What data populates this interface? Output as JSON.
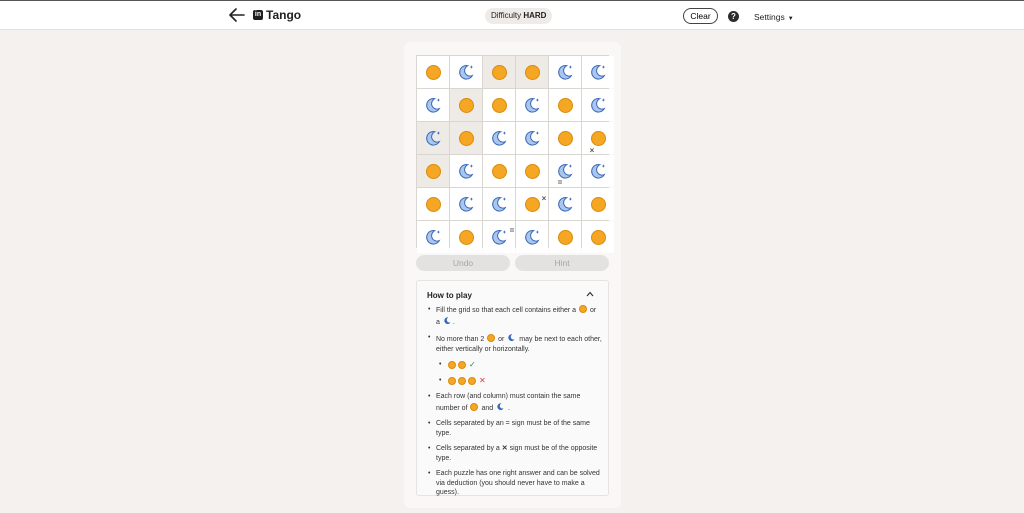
{
  "header": {
    "title": "Tango",
    "logo_text": "in",
    "difficulty_label": "Difficulty",
    "difficulty_value": "HARD",
    "clear_label": "Clear",
    "help_label": "?",
    "settings_label": "Settings"
  },
  "grid": {
    "rows": [
      [
        "sun",
        "moon",
        "sun",
        "sun",
        "moon",
        "moon"
      ],
      [
        "moon",
        "sun",
        "sun",
        "moon",
        "sun",
        "moon"
      ],
      [
        "moon",
        "sun",
        "moon",
        "moon",
        "sun",
        "sun"
      ],
      [
        "sun",
        "moon",
        "sun",
        "sun",
        "moon",
        "moon"
      ],
      [
        "sun",
        "moon",
        "moon",
        "sun",
        "moon",
        "sun"
      ],
      [
        "moon",
        "sun",
        "moon",
        "moon",
        "sun",
        "sun"
      ]
    ],
    "locked": [
      [
        false,
        false,
        true,
        true,
        false,
        false
      ],
      [
        false,
        true,
        false,
        false,
        false,
        false
      ],
      [
        true,
        true,
        false,
        false,
        false,
        false
      ],
      [
        true,
        false,
        false,
        false,
        false,
        false
      ],
      [
        false,
        false,
        false,
        false,
        false,
        false
      ],
      [
        false,
        false,
        false,
        false,
        false,
        false
      ]
    ],
    "constraints": [
      {
        "symbol": "×"
      },
      {
        "symbol": "="
      },
      {
        "symbol": "×"
      },
      {
        "symbol": "="
      }
    ]
  },
  "actions": {
    "undo_label": "Undo",
    "hint_label": "Hint"
  },
  "how_to_play": {
    "title": "How to play",
    "rule1_a": "Fill the grid so that each cell contains either a",
    "rule1_b": "or a",
    "rule1_c": ".",
    "rule2_a": "No more than 2",
    "rule2_b": "or",
    "rule2_c": "may be next to each other, either vertically or horizontally.",
    "ok_mark": "✓",
    "bad_mark": "✕",
    "rule3_a": "Each row (and column) must contain the same number of",
    "rule3_b": "and",
    "rule3_c": ".",
    "rule4": "Cells separated by an = sign must be of the same type.",
    "rule5_a": "Cells separated by a",
    "rule5_x": "✕",
    "rule5_b": "sign must be of the opposite type.",
    "rule6": "Each puzzle has one right answer and can be solved via deduction (you should never have to make a guess)."
  },
  "colors": {
    "sun_fill": "#f5a623",
    "moon_fill": "#a9c6ee",
    "moon_stroke": "#3a68b8"
  }
}
